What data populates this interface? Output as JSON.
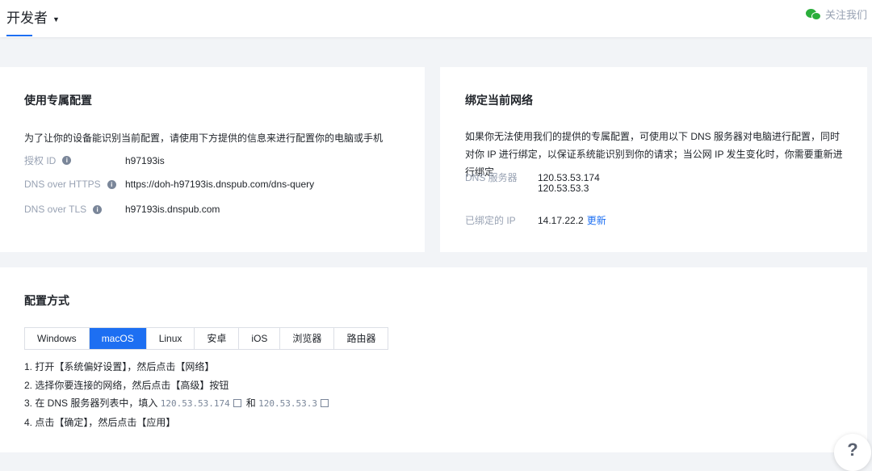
{
  "header": {
    "brand": "开发者",
    "follow": "关注我们",
    "icon": "wechat-icon"
  },
  "card1": {
    "title": "使用专属配置",
    "desc": "为了让你的设备能识别当前配置，请使用下方提供的信息来进行配置你的电脑或手机",
    "rows": [
      {
        "label": "授权 ID",
        "value": "h97193is"
      },
      {
        "label": "DNS over HTTPS",
        "value": "https://doh-h97193is.dnspub.com/dns-query"
      },
      {
        "label": "DNS over TLS",
        "value": "h97193is.dnspub.com"
      }
    ]
  },
  "card2": {
    "title": "绑定当前网络",
    "desc": "如果你无法使用我们的提供的专属配置，可使用以下 DNS 服务器对电脑进行配置，同时对你 IP 进行绑定，以保证系统能识别到你的请求；当公网 IP 发生变化时，你需要重新进行绑定",
    "dns_label": "DNS 服务器",
    "dns1": "120.53.53.174",
    "dns2": "120.53.53.3",
    "ip_label": "已绑定的 IP",
    "ip": "14.17.22.2",
    "update": "更新"
  },
  "card3": {
    "title": "配置方式",
    "tabs": [
      "Windows",
      "macOS",
      "Linux",
      "安卓",
      "iOS",
      "浏览器",
      "路由器"
    ],
    "active_tab": "macOS",
    "steps": {
      "s1": "1. 打开【系统偏好设置】，然后点击【网络】",
      "s2": "2. 选择你要连接的网络，然后点击【高级】按钮",
      "s3a": "3. 在 DNS 服务器列表中，填入",
      "ip1": "120.53.53.174",
      "and": "和",
      "ip2": "120.53.53.3",
      "s4": "4. 点击【确定】，然后点击【应用】"
    }
  },
  "help": "?",
  "colors": {
    "accent": "#1d6ff2",
    "wechat": "#2aae3b"
  }
}
